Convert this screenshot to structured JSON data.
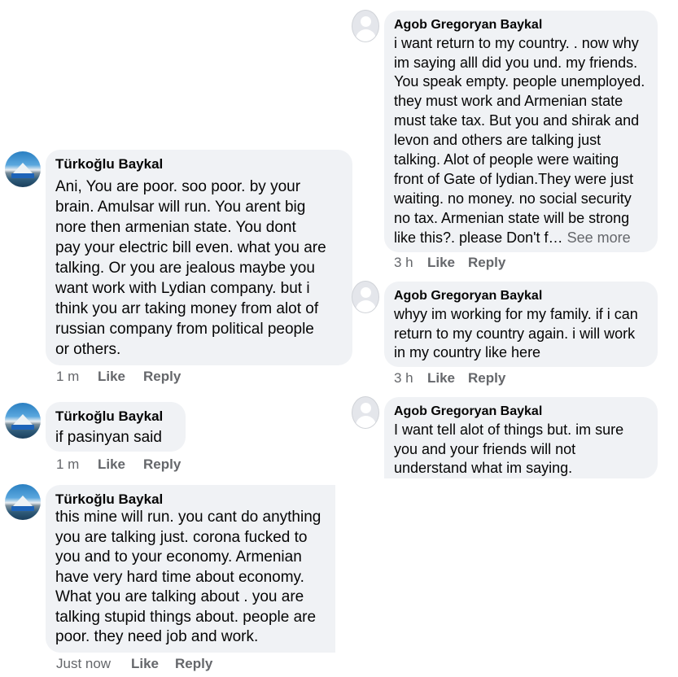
{
  "left_comments": [
    {
      "author": "Türkoğlu Baykal",
      "lines": [
        "Ani, You are poor. soo poor.  by your",
        "brain. Amulsar will run. You arent big",
        "nore then armenian state. You dont",
        "pay your electric bill even. what you are",
        "talking. Or you are jealous maybe you",
        "want work with Lydian company. but i",
        "think you arr taking money from alot of",
        "russian company from political people",
        "or others."
      ],
      "time": "1 m",
      "like": "Like",
      "reply": "Reply"
    },
    {
      "author": "Türkoğlu Baykal",
      "lines": [
        "if pasinyan said"
      ],
      "time": "1 m",
      "like": "Like",
      "reply": "Reply"
    },
    {
      "author": "Türkoğlu Baykal",
      "lines": [
        "this mine will run. you cant do anything",
        "you are talking just. corona fucked to",
        "you and to your economy. Armenian",
        "have very hard time about economy.",
        "What you are talking about . you are",
        "talking stupid things about. people are",
        "poor. they need job and work."
      ],
      "time": "Just now",
      "like": "Like",
      "reply": "Reply"
    }
  ],
  "right_comments": [
    {
      "author": "Agob Gregoryan Baykal",
      "lines": [
        "i want return to my country. . now why",
        "im saying alll did you und. my friends.",
        "You speak empty. people unemployed.",
        "they must work and Armenian state",
        "must take tax. But you and shirak and",
        "levon and others are talking just",
        "talking. Alot of people were waiting",
        "front of Gate of lydian.They were just",
        "waiting. no money. no social security",
        "no tax. Armenian state will be strong",
        "like this?. please Don't f…"
      ],
      "see_more": "See more",
      "time": "3 h",
      "like": "Like",
      "reply": "Reply"
    },
    {
      "author": "Agob Gregoryan Baykal",
      "lines": [
        "whyy im working for my family. if i can",
        "return to my country again. i will work",
        "in my country like here"
      ],
      "time": "3 h",
      "like": "Like",
      "reply": "Reply"
    },
    {
      "author": "Agob Gregoryan Baykal",
      "lines": [
        "I want tell alot of things but. im sure",
        "you and your friends will not",
        "understand what im saying."
      ]
    }
  ]
}
